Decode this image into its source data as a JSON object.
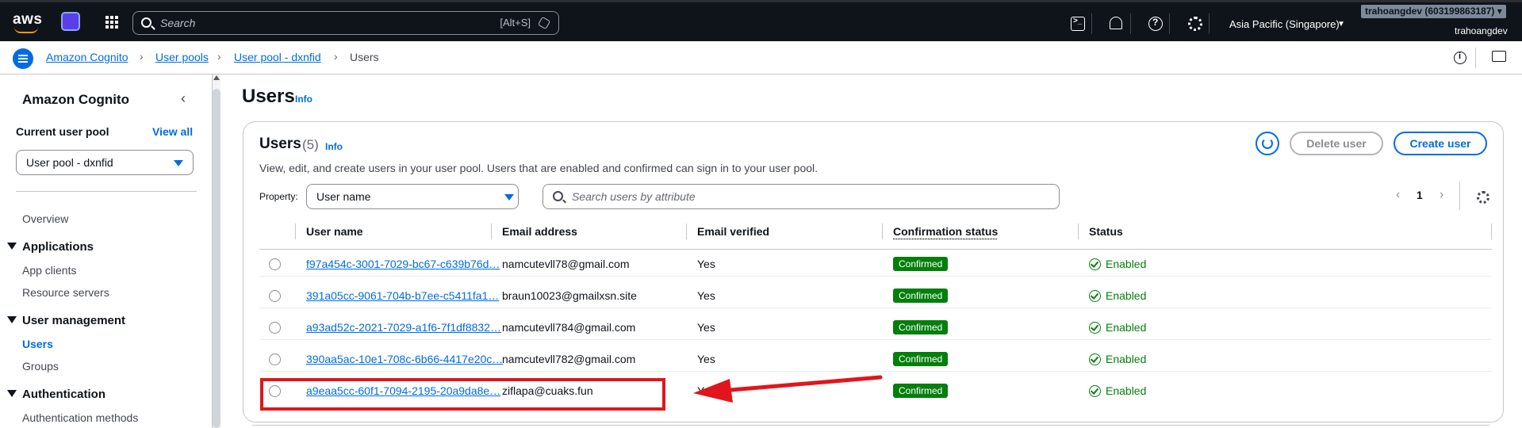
{
  "topnav": {
    "logo_text": "aws",
    "search_placeholder": "Search",
    "search_shortcut": "[Alt+S]",
    "region": "Asia Pacific (Singapore)",
    "account": "trahoangdev (603199863187)",
    "user": "trahoangdev",
    "icons": [
      "cloudshell-icon",
      "bell-icon",
      "help-icon",
      "gear-icon"
    ]
  },
  "breadcrumb": {
    "items": [
      "Amazon Cognito",
      "User pools",
      "User pool - dxnfid"
    ],
    "current": "Users"
  },
  "sidebar": {
    "title": "Amazon Cognito",
    "current_pool_label": "Current user pool",
    "view_all": "View all",
    "pool_value": "User pool - dxnfid",
    "overview": "Overview",
    "sections": [
      {
        "title": "Applications",
        "items": [
          "App clients",
          "Resource servers"
        ]
      },
      {
        "title": "User management",
        "items": [
          "Users",
          "Groups"
        ]
      },
      {
        "title": "Authentication",
        "items": [
          "Authentication methods"
        ]
      }
    ]
  },
  "page": {
    "title": "Users",
    "info": "Info"
  },
  "panel": {
    "title": "Users",
    "count": "(5)",
    "info": "Info",
    "description": "View, edit, and create users in your user pool. Users that are enabled and confirmed can sign in to your user pool.",
    "delete_label": "Delete user",
    "create_label": "Create user",
    "property_label": "Property:",
    "property_value": "User name",
    "search_placeholder": "Search users by attribute",
    "page_number": "1"
  },
  "table": {
    "headers": [
      "User name",
      "Email address",
      "Email verified",
      "Confirmation status",
      "Status"
    ],
    "rows": [
      {
        "user": "f97a454c-3001-7029-bc67-c639b76d…",
        "email": "namcutevll78@gmail.com",
        "verified": "Yes",
        "confirmation": "Confirmed",
        "status": "Enabled"
      },
      {
        "user": "391a05cc-9061-704b-b7ee-c5411fa1…",
        "email": "braun10023@gmailxsn.site",
        "verified": "Yes",
        "confirmation": "Confirmed",
        "status": "Enabled"
      },
      {
        "user": "a93ad52c-2021-7029-a1f6-7f1df8832…",
        "email": "namcutevll784@gmail.com",
        "verified": "Yes",
        "confirmation": "Confirmed",
        "status": "Enabled"
      },
      {
        "user": "390aa5ac-10e1-708c-6b66-4417e20c…",
        "email": "namcutevll782@gmail.com",
        "verified": "Yes",
        "confirmation": "Confirmed",
        "status": "Enabled"
      },
      {
        "user": "a9eaa5cc-60f1-7094-2195-20a9da8e…",
        "email": "ziflapa@cuaks.fun",
        "verified": "Yes",
        "confirmation": "Confirmed",
        "status": "Enabled"
      }
    ]
  },
  "colors": {
    "accent": "#006ce0",
    "success": "#037f0c",
    "annotation": "#e0161c",
    "topnav": "#0f141a"
  }
}
